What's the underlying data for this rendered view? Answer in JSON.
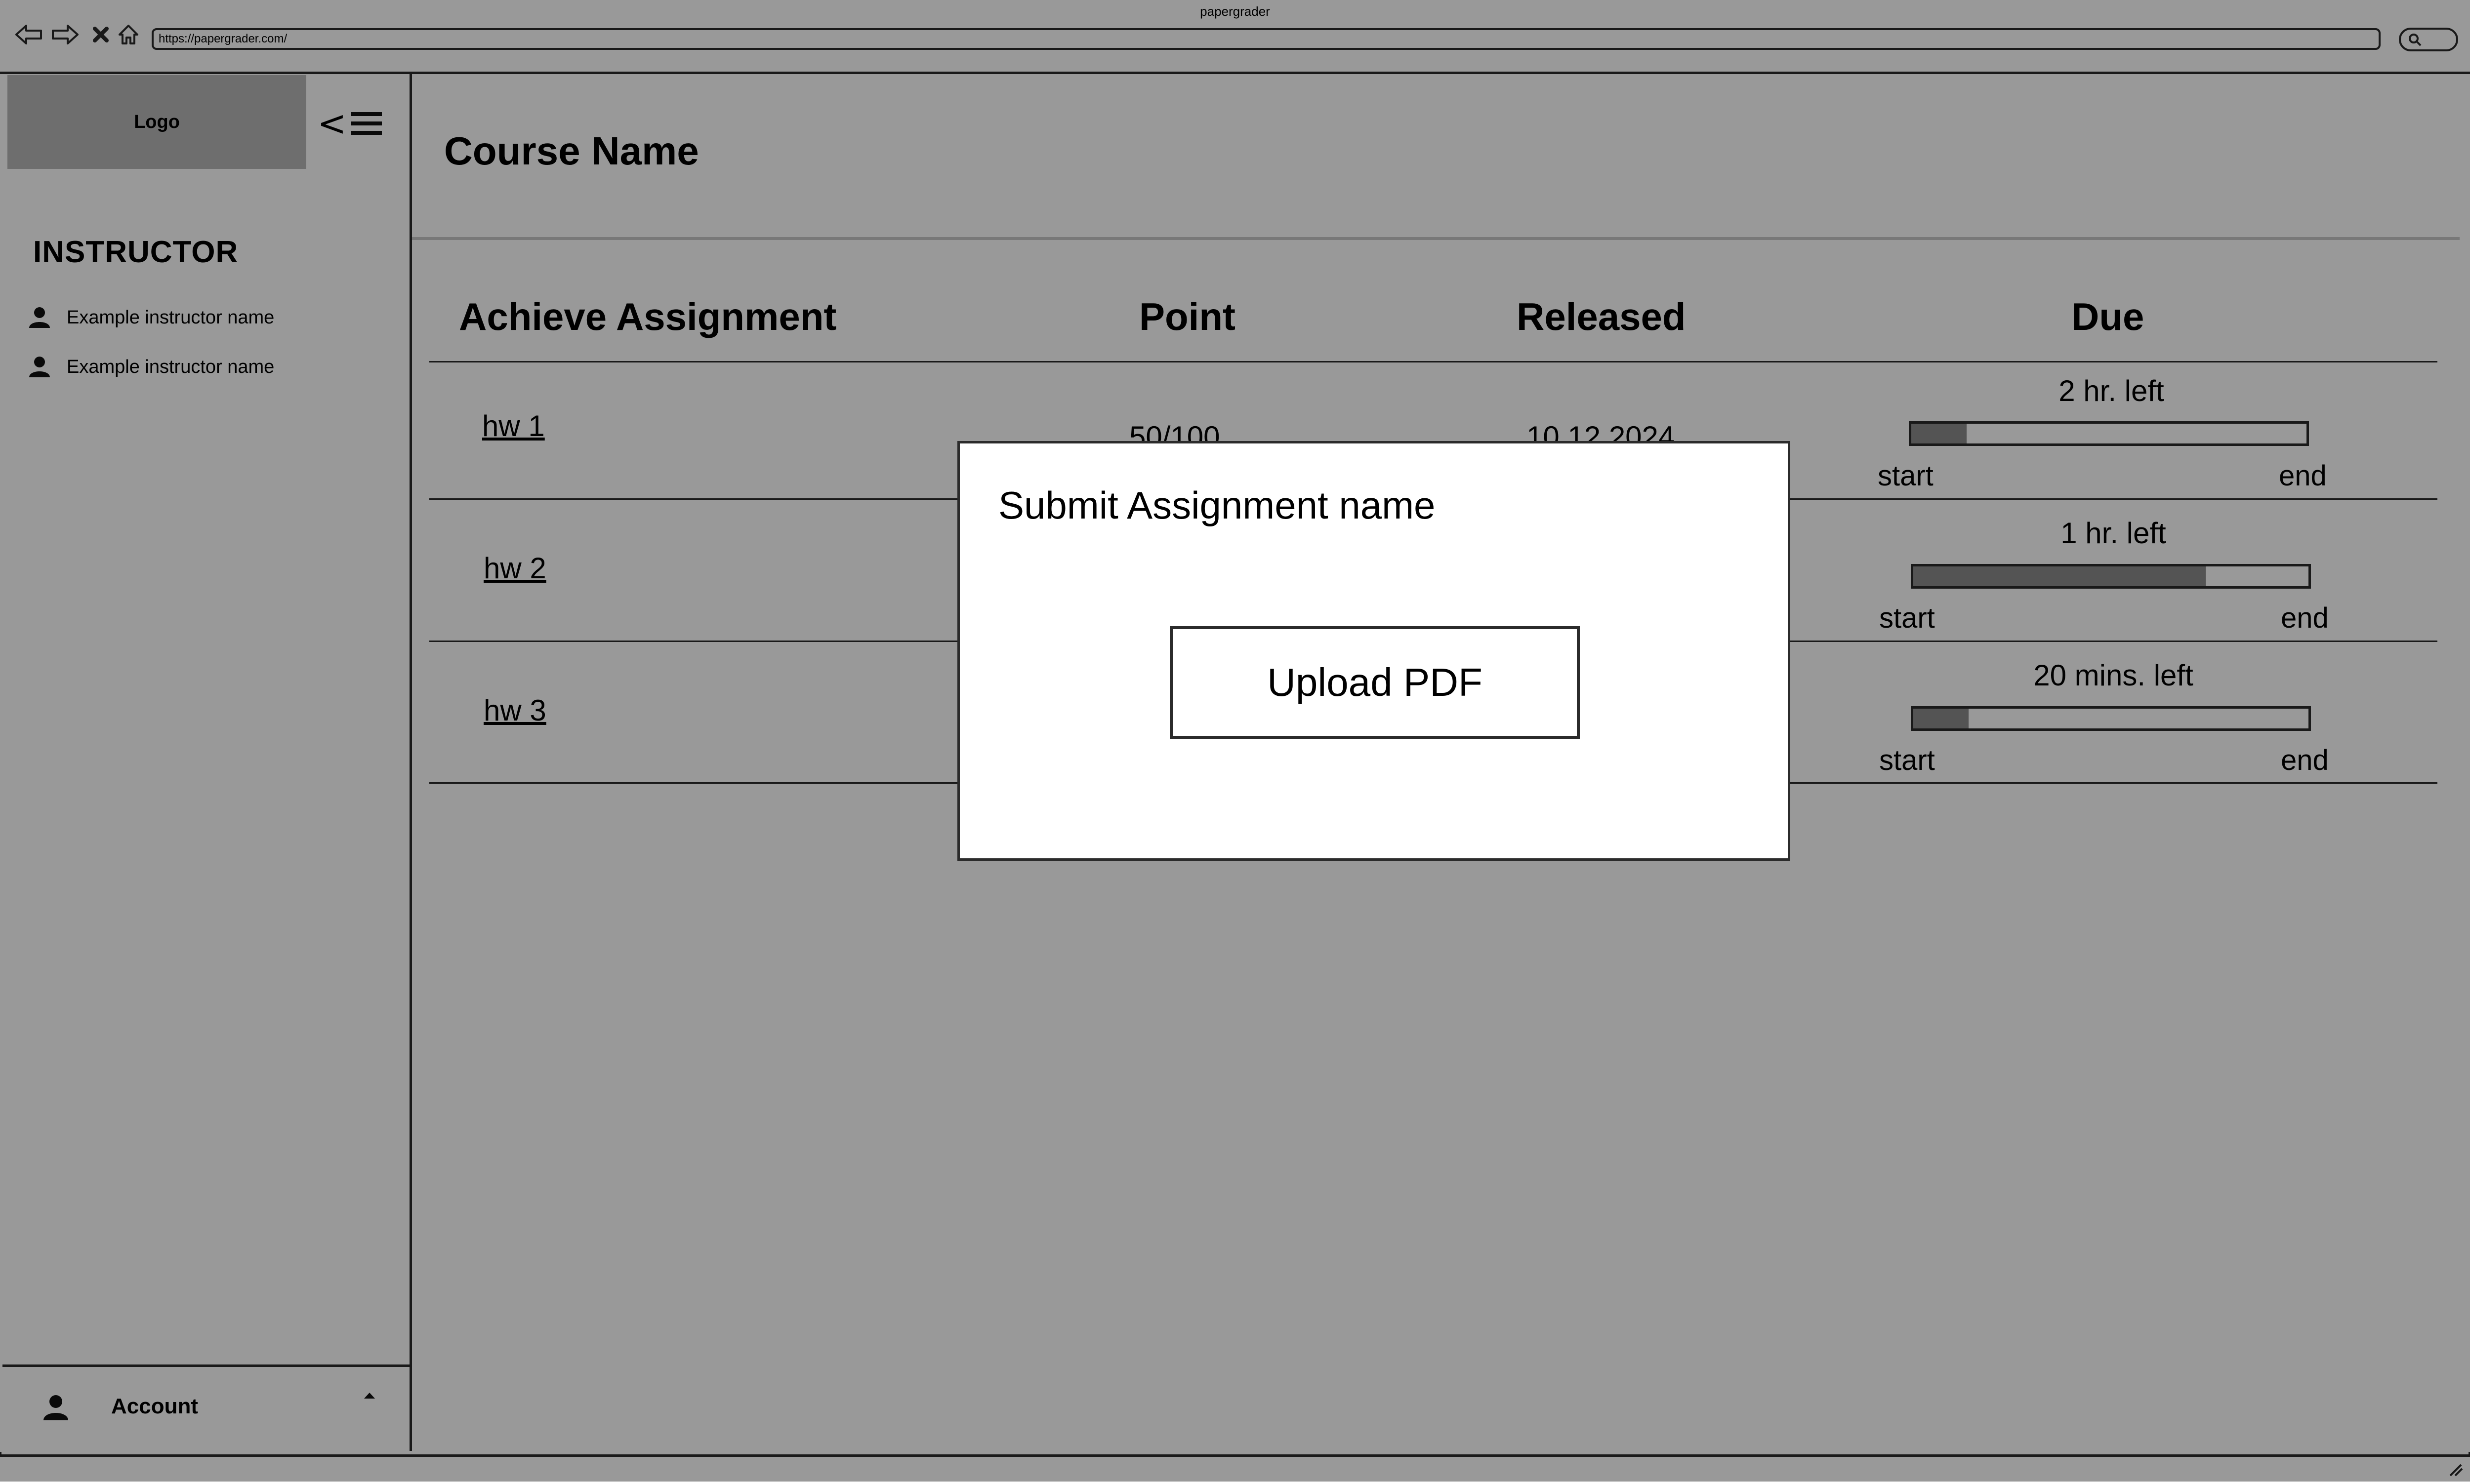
{
  "browser": {
    "window_title": "papergrader",
    "url": "https://papergrader.com/",
    "icons": [
      "back-arrow-icon",
      "forward-arrow-icon",
      "close-x-icon",
      "home-icon",
      "search-icon"
    ]
  },
  "sidebar": {
    "logo_text": "Logo",
    "collapse_icon": "collapse-menu-icon",
    "collapse_label": "<",
    "section_title": "INSTRUCTOR",
    "instructors": [
      {
        "name": "Example instructor name",
        "icon": "person-icon"
      },
      {
        "name": "Example instructor name",
        "icon": "person-icon"
      }
    ],
    "account": {
      "label": "Account",
      "icon": "person-icon",
      "caret_icon": "caret-up-icon"
    }
  },
  "main": {
    "course_title": "Course Name",
    "table": {
      "headers": {
        "assignment": "Achieve Assignment",
        "point": "Point",
        "released": "Released",
        "due": "Due"
      },
      "rows": [
        {
          "name": "hw 1",
          "point": "50/100",
          "released": "10.12.2024",
          "due_text": "2 hr. left",
          "progress": 0.14
        },
        {
          "name": "hw 2",
          "point": "",
          "released": "",
          "due_text": "1 hr. left",
          "progress": 0.74
        },
        {
          "name": "hw 3",
          "point": "",
          "released": "",
          "due_text": "20 mins. left",
          "progress": 0.14
        }
      ],
      "bar_start_label": "start",
      "bar_end_label": "end"
    }
  },
  "modal": {
    "title": "Submit Assignment name",
    "upload_button": "Upload PDF"
  },
  "colors": {
    "overlay": "#000000",
    "bar_fill": "#8c8c8c",
    "logo_bg": "#b8b8b8",
    "stroke": "#2b2b2b"
  }
}
